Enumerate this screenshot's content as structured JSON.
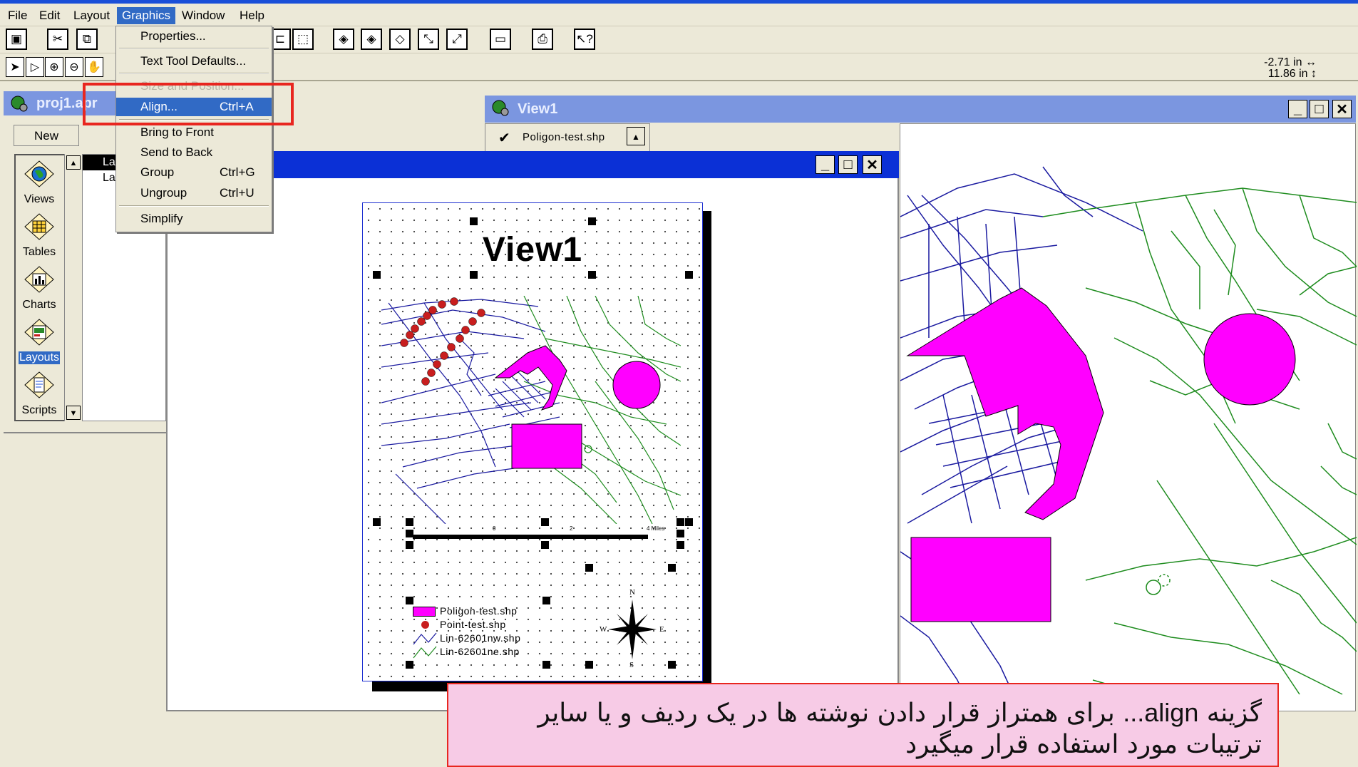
{
  "menubar": {
    "items": [
      {
        "label": "File"
      },
      {
        "label": "Edit"
      },
      {
        "label": "Layout"
      },
      {
        "label": "Graphics"
      },
      {
        "label": "Window"
      },
      {
        "label": "Help"
      }
    ]
  },
  "coords": {
    "x": "-2.71 in",
    "y": "11.86 in"
  },
  "graphics_menu": {
    "items": [
      {
        "label": "Properties...",
        "shortcut": ""
      },
      {
        "label": "Text Tool Defaults...",
        "shortcut": ""
      },
      {
        "label": "Size and Position...",
        "shortcut": ""
      },
      {
        "label": "Align...",
        "shortcut": "Ctrl+A"
      },
      {
        "label": "Bring to Front",
        "shortcut": ""
      },
      {
        "label": "Send to Back",
        "shortcut": ""
      },
      {
        "label": "Group",
        "shortcut": "Ctrl+G"
      },
      {
        "label": "Ungroup",
        "shortcut": "Ctrl+U"
      },
      {
        "label": "Simplify",
        "shortcut": ""
      }
    ]
  },
  "project": {
    "title": "proj1.apr",
    "new_label": "New",
    "icons": [
      "Views",
      "Tables",
      "Charts",
      "Layouts",
      "Scripts"
    ],
    "selected": "Layouts",
    "list": [
      "La",
      "Lay"
    ]
  },
  "view_window": {
    "title": "View1",
    "theme_name": "Poligon-test.shp"
  },
  "layout": {
    "page_title": "View1",
    "scalebar": [
      "0",
      "2",
      "4 Miles"
    ],
    "legend": [
      {
        "label": "Poligon-test.shp",
        "color": "#ff00ff"
      },
      {
        "label": "Point-test.shp",
        "color": "#c81e1e"
      },
      {
        "label": "Lin-62601nw.shp",
        "color": "#1a1aa0"
      },
      {
        "label": "Lin-62601ne.shp",
        "color": "#1e8c1e"
      }
    ],
    "north_arrow": {
      "n": "N",
      "s": "S",
      "e": "E",
      "w": "W"
    }
  },
  "caption": {
    "pre": "گزینه ",
    "highlight": "...align",
    "post": " برای همتراز قرار دادن نوشته ها در یک ردیف و یا سایر ترتیبات مورد استفاده قرار میگیرد"
  },
  "colors": {
    "titlebar": "#0b30d6",
    "polygon": "#ff00ff",
    "highlight": "#e8261f"
  }
}
